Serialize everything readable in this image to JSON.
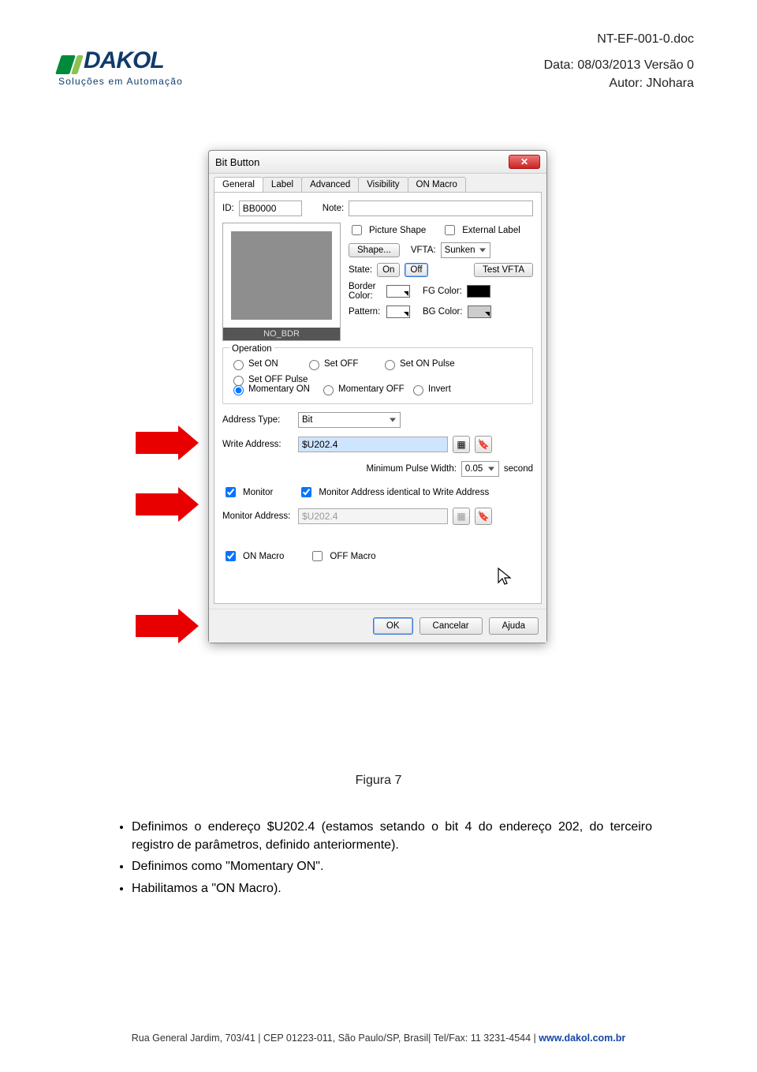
{
  "header": {
    "logo_main": "DAKOL",
    "logo_sub": "Soluções em Automação",
    "docname": "NT-EF-001-0.doc",
    "date_line": "Data: 08/03/2013    Versão 0",
    "author_line": "Autor: JNohara"
  },
  "dialog": {
    "title": "Bit Button",
    "tabs": [
      "General",
      "Label",
      "Advanced",
      "Visibility",
      "ON Macro"
    ],
    "id_label": "ID:",
    "id_value": "BB0000",
    "note_label": "Note:",
    "note_value": "",
    "preview_caption": "NO_BDR",
    "picture_shape": "Picture Shape",
    "external_label": "External Label",
    "shape_btn": "Shape...",
    "vfta_label": "VFTA:",
    "vfta_value": "Sunken",
    "state_label": "State:",
    "state_on": "On",
    "state_off": "Off",
    "test_vfta": "Test VFTA",
    "border_color_label": "Border Color:",
    "fg_color_label": "FG Color:",
    "pattern_label": "Pattern:",
    "bg_color_label": "BG Color:",
    "operation": {
      "title": "Operation",
      "options": [
        "Set ON",
        "Set OFF",
        "Set ON Pulse",
        "Set OFF Pulse",
        "Momentary ON",
        "Momentary OFF",
        "Invert"
      ],
      "selected": "Momentary ON"
    },
    "address_type_label": "Address Type:",
    "address_type_value": "Bit",
    "write_address_label": "Write Address:",
    "write_address_value": "$U202.4",
    "min_pulse_label": "Minimum Pulse Width:",
    "min_pulse_value": "0.05",
    "min_pulse_unit": "second",
    "monitor_label": "Monitor",
    "monitor_identical_label": "Monitor Address identical to Write Address",
    "monitor_address_label": "Monitor Address:",
    "monitor_address_value": "$U202.4",
    "on_macro": "ON Macro",
    "off_macro": "OFF Macro",
    "buttons": {
      "ok": "OK",
      "cancel": "Cancelar",
      "help": "Ajuda"
    }
  },
  "caption": "Figura 7",
  "bullets": {
    "b1": "Definimos o endereço $U202.4 (estamos setando o bit 4 do endereço 202, do terceiro registro de parâmetros, definido anteriormente).",
    "b2": "Definimos como \"Momentary ON\".",
    "b3": "Habilitamos a \"ON Macro)."
  },
  "footer": {
    "text": "Rua General Jardim, 703/41 | CEP 01223-011, São Paulo/SP, Brasil| Tel/Fax: 11 3231-4544 | ",
    "link": "www.dakol.com.br"
  }
}
